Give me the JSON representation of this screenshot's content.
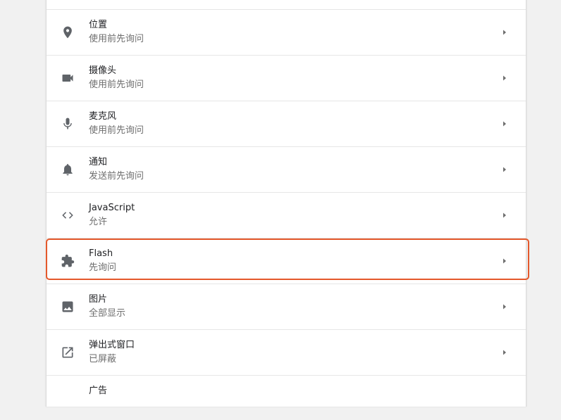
{
  "settings": {
    "rows": [
      {
        "title": "",
        "subtitle": "",
        "icon": ""
      },
      {
        "title": "位置",
        "subtitle": "使用前先询问",
        "icon": "location-pin-icon"
      },
      {
        "title": "摄像头",
        "subtitle": "使用前先询问",
        "icon": "videocam-icon"
      },
      {
        "title": "麦克风",
        "subtitle": "使用前先询问",
        "icon": "microphone-icon"
      },
      {
        "title": "通知",
        "subtitle": "发送前先询问",
        "icon": "bell-icon"
      },
      {
        "title": "JavaScript",
        "subtitle": "允许",
        "icon": "code-icon"
      },
      {
        "title": "Flash",
        "subtitle": "先询问",
        "icon": "puzzle-piece-icon"
      },
      {
        "title": "图片",
        "subtitle": "全部显示",
        "icon": "image-icon"
      },
      {
        "title": "弹出式窗口",
        "subtitle": "已屏蔽",
        "icon": "open-in-new-icon"
      },
      {
        "title": "广告",
        "subtitle": "",
        "icon": ""
      }
    ]
  },
  "colors": {
    "highlight_border": "#e4582b",
    "icon": "#5f6368",
    "title": "#202124",
    "subtitle": "#6e6e6e",
    "background": "#f1f1f1"
  }
}
